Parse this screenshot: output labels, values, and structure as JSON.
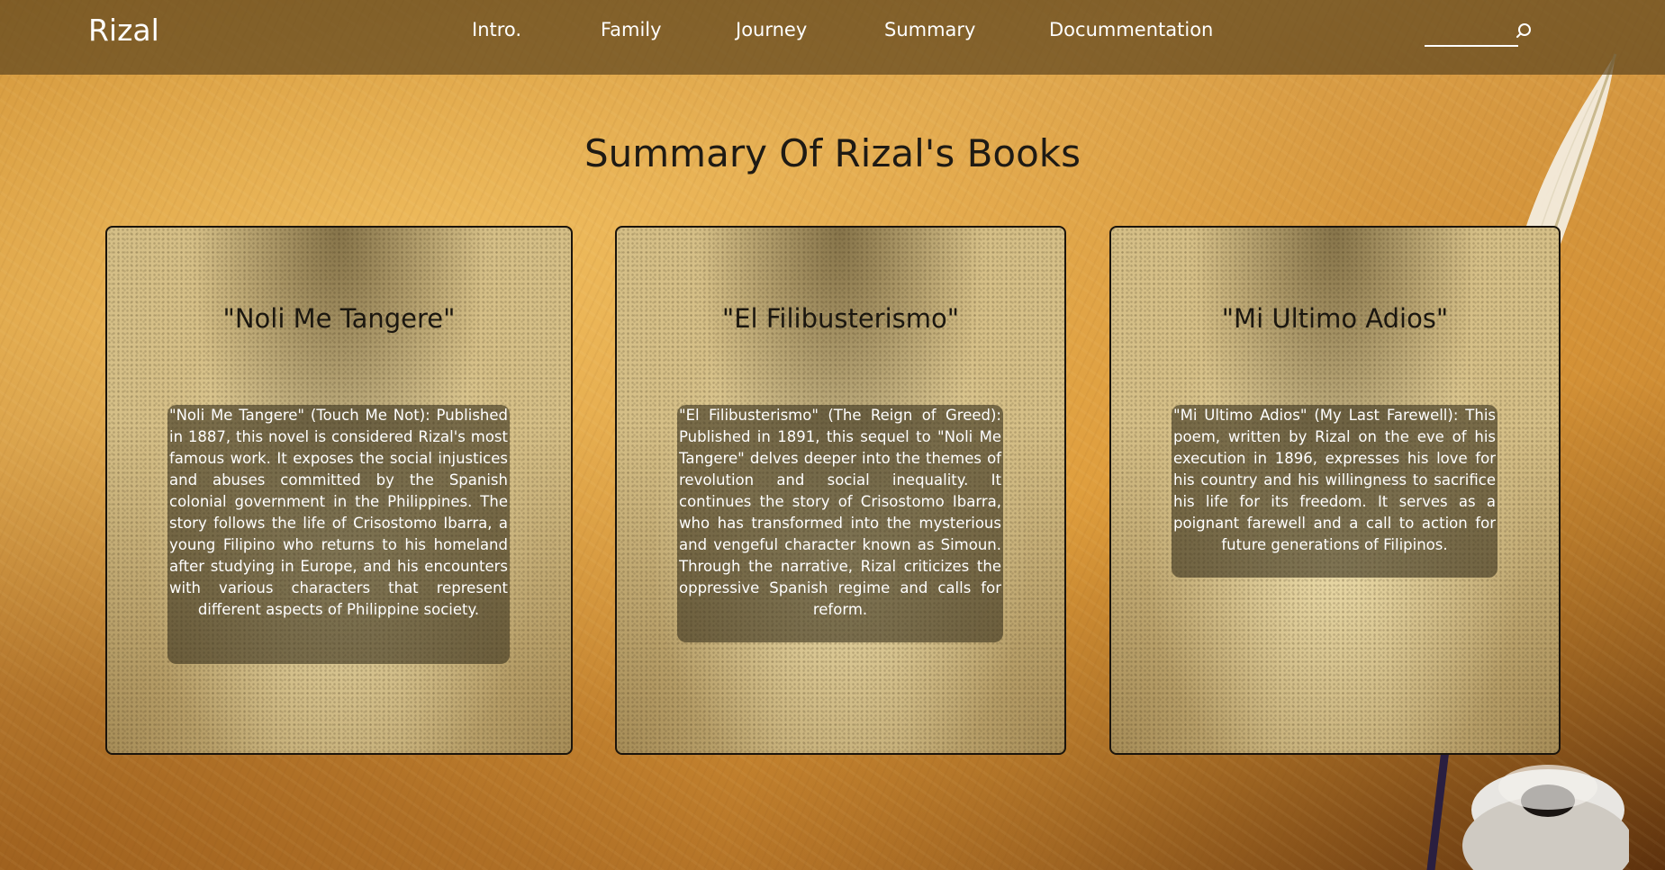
{
  "colors": {
    "navbar_bg": "#5f461e",
    "nav_text": "#ffffff",
    "title_text": "#1e1a14",
    "card_border": "#1a140c",
    "summary_box": "#3c341e"
  },
  "navbar": {
    "brand": "Rizal",
    "items": [
      {
        "label": "Intro."
      },
      {
        "label": "Family"
      },
      {
        "label": "Journey"
      },
      {
        "label": "Summary"
      },
      {
        "label": "Docummentation"
      }
    ],
    "search": {
      "placeholder": "",
      "value": "",
      "icon": "search-icon"
    }
  },
  "page": {
    "title": "Summary Of Rizal's Books"
  },
  "cards": [
    {
      "title": "\"Noli Me Tangere\"",
      "summary": "\"Noli Me Tangere\" (Touch Me Not): Published in 1887, this novel is considered Rizal's most famous work. It exposes the social injustices and abuses committed by the Spanish colonial government in the Philippines. The story follows the life of Crisostomo Ibarra, a young Filipino who returns to his homeland after studying in Europe, and his encounters with various characters that represent different aspects of Philippine society."
    },
    {
      "title": "\"El Filibusterismo\"",
      "summary": "\"El Filibusterismo\" (The Reign of Greed): Published in 1891, this sequel to \"Noli Me Tangere\" delves deeper into the themes of revolution and social inequality. It continues the story of Crisostomo Ibarra, who has transformed into the mysterious and vengeful character known as Simoun. Through the narrative, Rizal criticizes the oppressive Spanish regime and calls for reform."
    },
    {
      "title": "\"Mi Ultimo Adios\"",
      "summary": "\"Mi Ultimo Adios\" (My Last Farewell): This poem, written by Rizal on the eve of his execution in 1896, expresses his love for his country and his willingness to sacrifice his life for its freedom. It serves as a poignant farewell and a call to action for future generations of Filipinos."
    }
  ]
}
